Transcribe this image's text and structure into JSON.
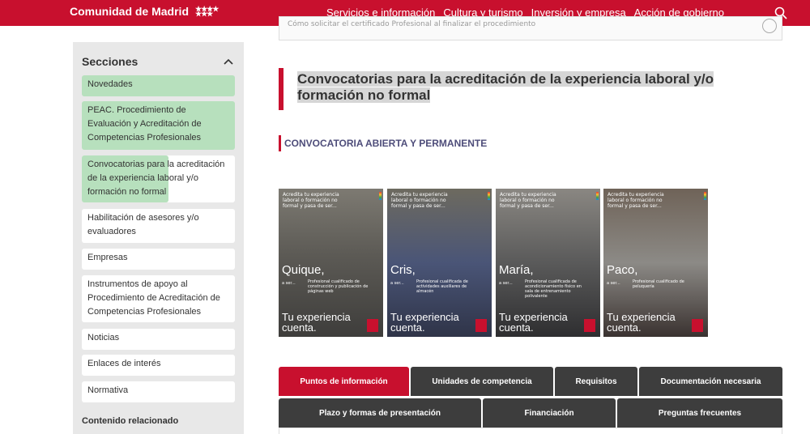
{
  "header": {
    "brand": "Comunidad de Madrid",
    "nav": [
      "Servicios e información",
      "Cultura y turismo",
      "Inversión y empresa",
      "Acción de gobierno"
    ]
  },
  "snippet": "Cómo solicitar el certificado Profesional al finalizar el procedimiento",
  "sidebar": {
    "title": "Secciones",
    "items": [
      "Novedades",
      "PEAC. Procedimiento de Evaluación y Acreditación de Competencias Profesionales",
      "Convocatorias para la acreditación de la experiencia laboral y/o formación no formal",
      "Habilitación de asesores y/o evaluadores",
      "Empresas",
      "Instrumentos de apoyo al Procedimiento de Acreditación de Competencias Profesionales",
      "Noticias",
      "Enlaces de interés",
      "Normativa"
    ],
    "related": "Contenido relacionado"
  },
  "main": {
    "title": "Convocatorias para la acreditación de la experiencia laboral y/o formación no formal",
    "subtitle": "CONVOCATORIA ABIERTA Y PERMANENTE"
  },
  "cards": [
    {
      "head": "Acredita tu experiencia laboral o formación no formal y pasa de ser...",
      "name": "Quique,",
      "es_un": "a ser...",
      "prof": "Profesional cualificado de construcción y publicación de páginas web",
      "tagline": "Tu experiencia cuenta."
    },
    {
      "head": "Acredita tu experiencia laboral o formación no formal y pasa de ser...",
      "name": "Cris,",
      "es_un": "a ser...",
      "prof": "Profesional cualificada de actividades auxiliares de almacén",
      "tagline": "Tu experiencia cuenta."
    },
    {
      "head": "Acredita tu experiencia laboral o formación no formal y pasa de ser...",
      "name": "María,",
      "es_un": "a ser...",
      "prof": "Profesional cualificada de acondicionamiento físico en sala de entrenamiento polivalente",
      "tagline": "Tu experiencia cuenta."
    },
    {
      "head": "Acredita tu experiencia laboral o formación no formal y pasa de ser...",
      "name": "Paco,",
      "es_un": "a ser...",
      "prof": "Profesional cualificado de peluquería",
      "tagline": "Tu experiencia cuenta."
    }
  ],
  "tabs_row1": [
    "Puntos de información",
    "Unidades de competencia",
    "Requisitos",
    "Documentación necesaria"
  ],
  "tabs_row2": [
    "Plazo y formas de presentación",
    "Financiación",
    "Preguntas frecuentes"
  ],
  "colors": {
    "brand_red": "#c8102e",
    "sidebar_green": "#b7e0bd",
    "tab_dark": "#3d3d3d",
    "subtitle_purple": "#4e4d7a"
  }
}
